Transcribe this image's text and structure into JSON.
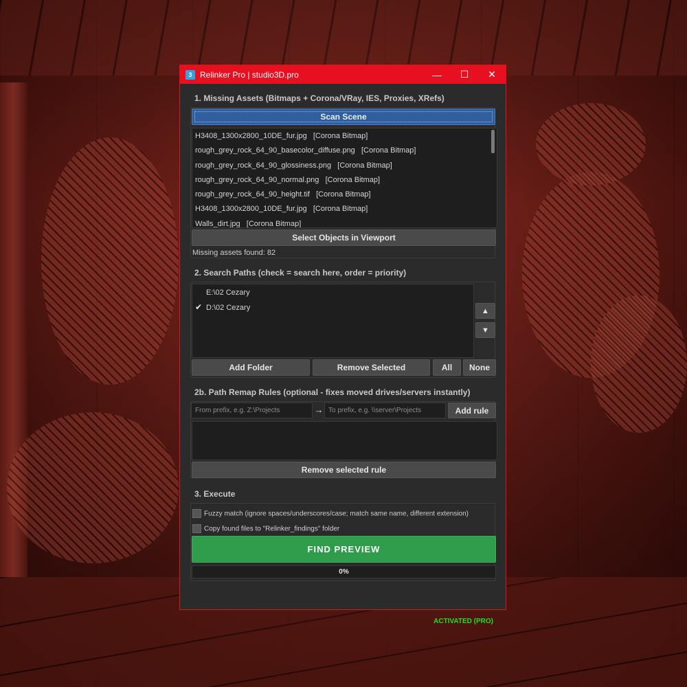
{
  "window": {
    "title": "Relinker Pro | studio3D.pro",
    "app_icon_glyph": "3",
    "minimize_glyph": "—",
    "maximize_glyph": "☐",
    "close_glyph": "✕"
  },
  "section1": {
    "title": "1. Missing Assets (Bitmaps + Corona/VRay, IES, Proxies, XRefs)",
    "scan_label": "Scan Scene",
    "assets": [
      "H3408_1300x2800_10DE_fur.jpg   [Corona Bitmap]",
      "rough_grey_rock_64_90_basecolor_diffuse.png   [Corona Bitmap]",
      "rough_grey_rock_64_90_glossiness.png   [Corona Bitmap]",
      "rough_grey_rock_64_90_normal.png   [Corona Bitmap]",
      "rough_grey_rock_64_90_height.tif   [Corona Bitmap]",
      "H3408_1300x2800_10DE_fur.jpg   [Corona Bitmap]",
      "Walls_dirt.jpg   [Corona Bitmap]"
    ],
    "select_objects_label": "Select Objects in Viewport",
    "status": "Missing assets found: 82"
  },
  "section2": {
    "title": "2. Search Paths (check = search here, order = priority)",
    "paths": [
      {
        "check": "",
        "path": "E:\\02 Cezary"
      },
      {
        "check": "✔",
        "path": "D:\\02 Cezary"
      }
    ],
    "up_glyph": "▲",
    "down_glyph": "▼",
    "add_folder_label": "Add Folder",
    "remove_selected_label": "Remove Selected",
    "all_label": "All",
    "none_label": "None"
  },
  "section2b": {
    "title": "2b. Path Remap Rules (optional - fixes moved drives/servers instantly)",
    "from_placeholder": "From prefix, e.g.  Z:\\Projects",
    "arrow": "→",
    "to_placeholder": "To prefix, e.g.  \\\\server\\Projects",
    "add_rule_label": "Add rule",
    "remove_rule_label": "Remove selected rule"
  },
  "section3": {
    "title": "3. Execute",
    "fuzzy_label": "Fuzzy match (ignore spaces/underscores/case; match same name, different extension)",
    "copy_label": "Copy found files to \"Relinker_findings\" folder",
    "find_label": "FIND  PREVIEW",
    "progress_text": "0%",
    "progress_value": 0
  },
  "footer": {
    "activated": "ACTIVATED (PRO)"
  },
  "colors": {
    "titlebar": "#e61020",
    "scan_button": "#2f5f9e",
    "find_button": "#2e9c4a",
    "activated": "#20e020"
  }
}
